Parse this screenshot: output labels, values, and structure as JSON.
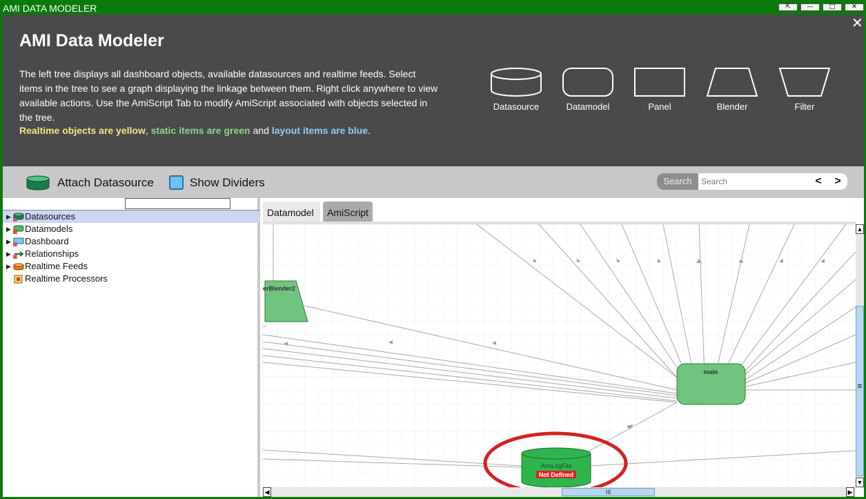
{
  "window": {
    "title": "AMI DATA MODELER",
    "buttons": {
      "popout": "⇱",
      "minimize": "—",
      "maximize": "□",
      "close": "✕"
    }
  },
  "header": {
    "title": "AMI Data Modeler",
    "description": "The left tree displays all dashboard objects, available datasources and realtime feeds. Select items in the tree to see a graph displaying the linkage between them. Right click anywhere to view available actions. Use the AmiScript Tab to modify AmiScript associated with objects selected in the tree.",
    "legend": {
      "yellow": "Realtime objects are yellow",
      "sep1": ", ",
      "green": "static items are green",
      "sep2": " and ",
      "blue": "layout items are blue",
      "end": "."
    },
    "close": "✕",
    "shapes": [
      "Datasource",
      "Datamodel",
      "Panel",
      "Blender",
      "Filter"
    ]
  },
  "toolbar": {
    "attach_label": "Attach Datasource",
    "dividers_label": "Show Dividers",
    "search_button": "Search",
    "search_placeholder": "Search",
    "prev": "<",
    "next": ">"
  },
  "tree": {
    "items": [
      {
        "label": "Datasources",
        "icon": "datasource-icon",
        "expandable": true,
        "selected": true
      },
      {
        "label": "Datamodels",
        "icon": "datamodel-icon",
        "expandable": true,
        "selected": false
      },
      {
        "label": "Dashboard",
        "icon": "dashboard-icon",
        "expandable": true,
        "selected": false
      },
      {
        "label": "Relationships",
        "icon": "relationship-icon",
        "expandable": true,
        "selected": false
      },
      {
        "label": "Realtime Feeds",
        "icon": "realtime-feed-icon",
        "expandable": true,
        "selected": false
      },
      {
        "label": "Realtime Processors",
        "icon": "realtime-processor-icon",
        "expandable": false,
        "selected": false
      }
    ]
  },
  "tabs": [
    {
      "label": "Datamodel",
      "active": true
    },
    {
      "label": "AmiScript",
      "active": false
    }
  ],
  "graph": {
    "blender_label": "erBlender2",
    "datamodel_label": "main",
    "datasource_label": "AmiLogFile",
    "datasource_status": "Not Defined"
  },
  "colors": {
    "window_frame": "#0a7a0a",
    "header_bg": "#4a4a4a",
    "node_green": "#71c47e",
    "datasource_green": "#2fb54e",
    "error_red": "#e32020",
    "highlight_ring": "#d42222"
  },
  "scrollbars": {
    "up": "▲",
    "down": "▼",
    "left": "◀",
    "right": "▶",
    "grip_v": "≡",
    "grip_h": "III"
  }
}
